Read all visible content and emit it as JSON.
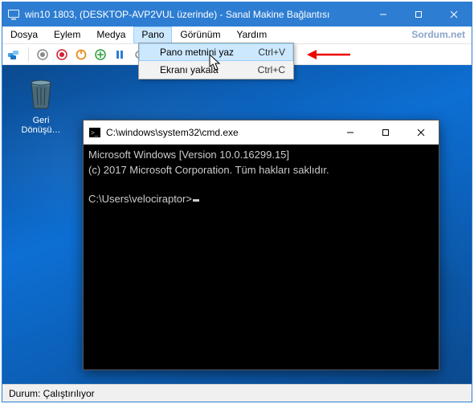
{
  "titlebar": {
    "title": "win10 1803, (DESKTOP-AVP2VUL üzerinde) - Sanal Makine Bağlantısı"
  },
  "menubar": {
    "items": [
      "Dosya",
      "Eylem",
      "Medya",
      "Pano",
      "Görünüm",
      "Yardım"
    ],
    "active_index": 3,
    "watermark": "Sordum.net"
  },
  "dropdown": {
    "items": [
      {
        "label": "Pano metnini yaz",
        "shortcut": "Ctrl+V",
        "hover": true
      },
      {
        "label": "Ekranı yakala",
        "shortcut": "Ctrl+C",
        "hover": false
      }
    ]
  },
  "desktop_icon": {
    "label": "Geri Dönüşü…"
  },
  "cmd": {
    "title": "C:\\windows\\system32\\cmd.exe",
    "line1": "Microsoft Windows [Version 10.0.16299.15]",
    "line2": "(c) 2017 Microsoft Corporation. Tüm hakları saklıdır.",
    "prompt": "C:\\Users\\velociraptor>"
  },
  "statusbar": {
    "text": "Durum: Çalıştırılıyor"
  }
}
